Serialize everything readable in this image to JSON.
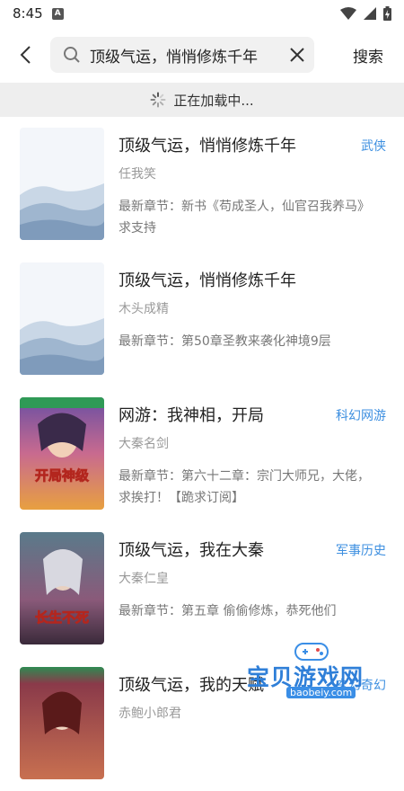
{
  "status": {
    "time": "8:45",
    "app_icon": "A"
  },
  "search": {
    "query": "顶级气运，悄悄修炼千年",
    "button": "搜索"
  },
  "loading": {
    "text": "正在加载中..."
  },
  "books": [
    {
      "title": "顶级气运，悄悄修炼千年",
      "tag": "武侠",
      "author": "任我笑",
      "chapter": "最新章节：新书《苟成圣人，仙官召我养马》求支持",
      "cover": "landscape"
    },
    {
      "title": "顶级气运，悄悄修炼千年",
      "tag": "",
      "author": "木头成精",
      "chapter": "最新章节：第50章圣教来袭化神境9层",
      "cover": "landscape"
    },
    {
      "title": "网游：我神相，开局",
      "tag": "科幻网游",
      "author": "大秦名剑",
      "chapter": "最新章节：第六十二章：宗门大师兄，大佬，求挨打！【跪求订阅】",
      "cover": "art1",
      "cover_text": "开局神级"
    },
    {
      "title": "顶级气运，我在大秦",
      "tag": "军事历史",
      "author": "大秦仁皇",
      "chapter": "最新章节：第五章 偷偷修炼，恭死他们",
      "cover": "art2",
      "cover_text": "长生不死"
    },
    {
      "title": "顶级气运，我的天赋",
      "tag": "玄幻奇幻",
      "author": "赤鲍小郎君",
      "chapter": "",
      "cover": "art3"
    }
  ],
  "watermark": {
    "title": "宝贝游戏网",
    "url": "baobeiy.com"
  }
}
